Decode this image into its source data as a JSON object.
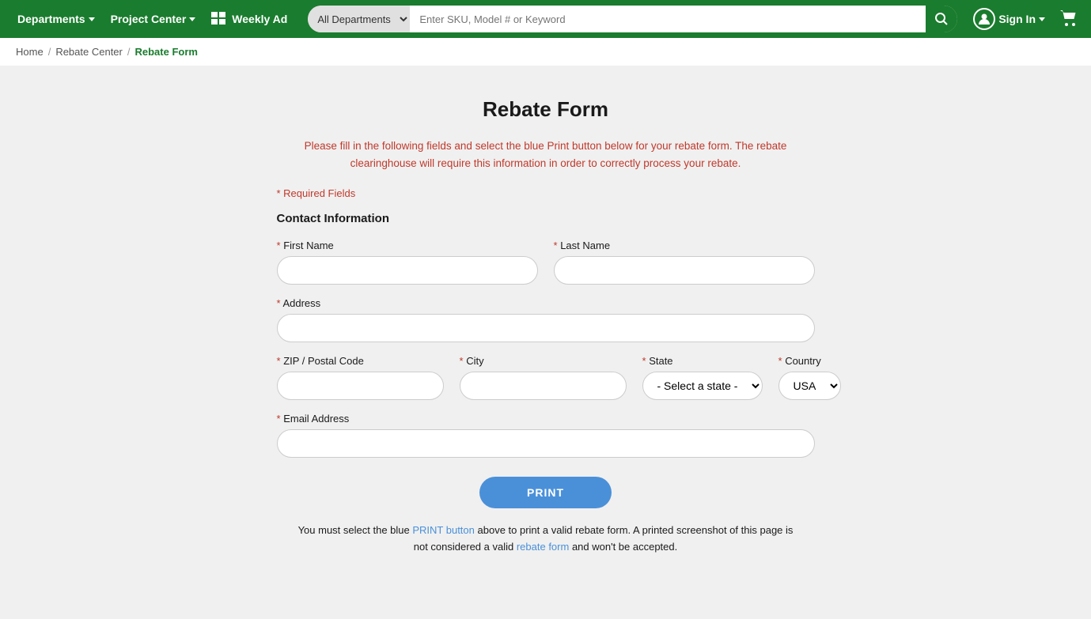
{
  "header": {
    "departments_label": "Departments",
    "project_center_label": "Project Center",
    "weekly_ad_label": "Weekly Ad",
    "search_placeholder": "Enter SKU, Model # or Keyword",
    "all_departments_label": "All Departments",
    "sign_in_label": "Sign In"
  },
  "breadcrumb": {
    "home": "Home",
    "rebate_center": "Rebate Center",
    "current": "Rebate Form"
  },
  "form": {
    "title": "Rebate Form",
    "description": "Please fill in the following fields and select the blue Print button below for your rebate form. The rebate clearinghouse will require this information in order to correctly process your rebate.",
    "required_note": "* Required Fields",
    "contact_section_title": "Contact Information",
    "first_name_label": "* First Name",
    "last_name_label": "* Last Name",
    "address_label": "* Address",
    "zip_label": "* ZIP / Postal Code",
    "city_label": "* City",
    "state_label": "* State",
    "country_label": "* Country",
    "email_label": "* Email Address",
    "state_placeholder": "- Select a state -",
    "country_default": "USA",
    "print_button": "PRINT",
    "print_note": "You must select the blue PRINT button above to print a valid rebate form. A printed screenshot of this page is not considered a valid rebate form and won't be accepted."
  }
}
